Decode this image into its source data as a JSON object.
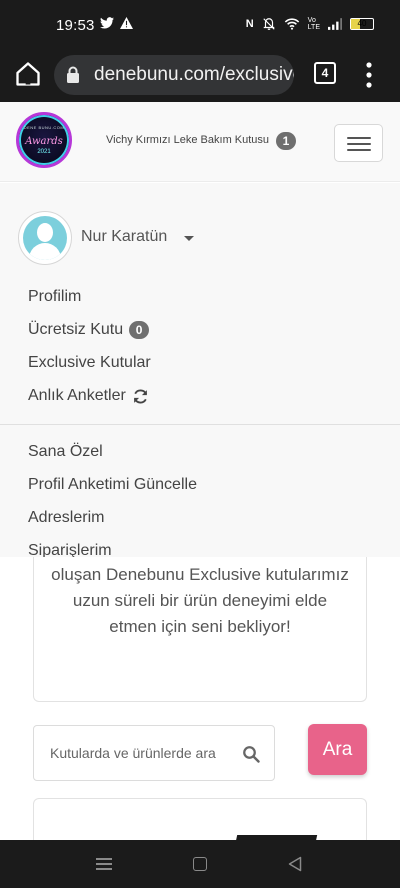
{
  "status_bar": {
    "time": "19:53",
    "battery_level": "40",
    "notification_icons": [
      "twitter-icon",
      "warning-icon"
    ],
    "system_icons": [
      "nfc-icon",
      "mute-icon",
      "wifi-icon",
      "volte-icon",
      "signal-icon",
      "battery-icon"
    ]
  },
  "browser": {
    "url": "denebunu.com/exclusive",
    "tab_count": "4"
  },
  "header": {
    "logo": {
      "line1": "DENE BUNU.COM",
      "line2": "Awards",
      "line3": "2021"
    },
    "cart_text": "Vichy Kırmızı Leke Bakım Kutusu",
    "cart_count": "1"
  },
  "user_menu": {
    "username": "Nur Karatün",
    "items_group1": [
      {
        "label": "Profilim"
      },
      {
        "label": "Ücretsiz Kutu",
        "badge": "0"
      },
      {
        "label": "Exclusive Kutular"
      },
      {
        "label": "Anlık Anketler",
        "icon": "refresh-icon"
      }
    ],
    "items_group2": [
      {
        "label": "Sana Özel"
      },
      {
        "label": "Profil Anketimi Güncelle"
      },
      {
        "label": "Adreslerim"
      },
      {
        "label": "Siparişlerim"
      }
    ]
  },
  "content": {
    "description": "oluşan Denebunu Exclusive kutularımız uzun süreli bir ürün deneyimi elde etmen için seni bekliyor!",
    "search_placeholder": "Kutularda ve ürünlerde ara",
    "search_button": "Ara"
  },
  "colors": {
    "accent_pink": "#e8638a",
    "badge_gray": "#6f6f6f",
    "avatar_teal": "#7ccfdc",
    "system_bar": "#1b1b1b"
  }
}
